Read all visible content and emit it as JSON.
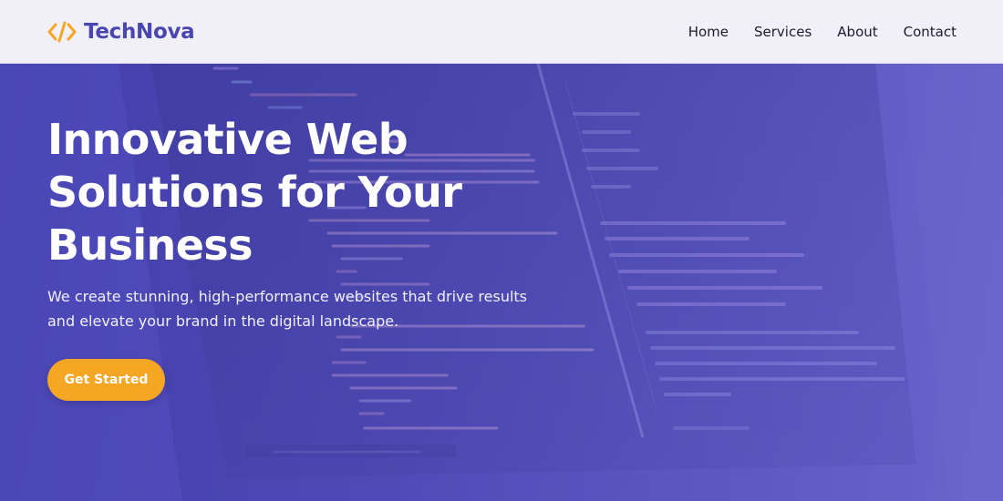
{
  "brand": {
    "name": "TechNova",
    "icon": "code-brackets-icon",
    "icon_color": "#f5a623",
    "text_color": "#4a46b0"
  },
  "nav": {
    "items": [
      {
        "label": "Home"
      },
      {
        "label": "Services"
      },
      {
        "label": "About"
      },
      {
        "label": "Contact"
      }
    ]
  },
  "hero": {
    "title": "Innovative Web Solutions for Your Business",
    "subtitle": "We create stunning, high-performance websites that drive results and elevate your brand in the digital landscape.",
    "cta_label": "Get Started",
    "cta_color": "#f5a623",
    "background": "code-editor-photo",
    "overlay_color": "#5450bd"
  }
}
